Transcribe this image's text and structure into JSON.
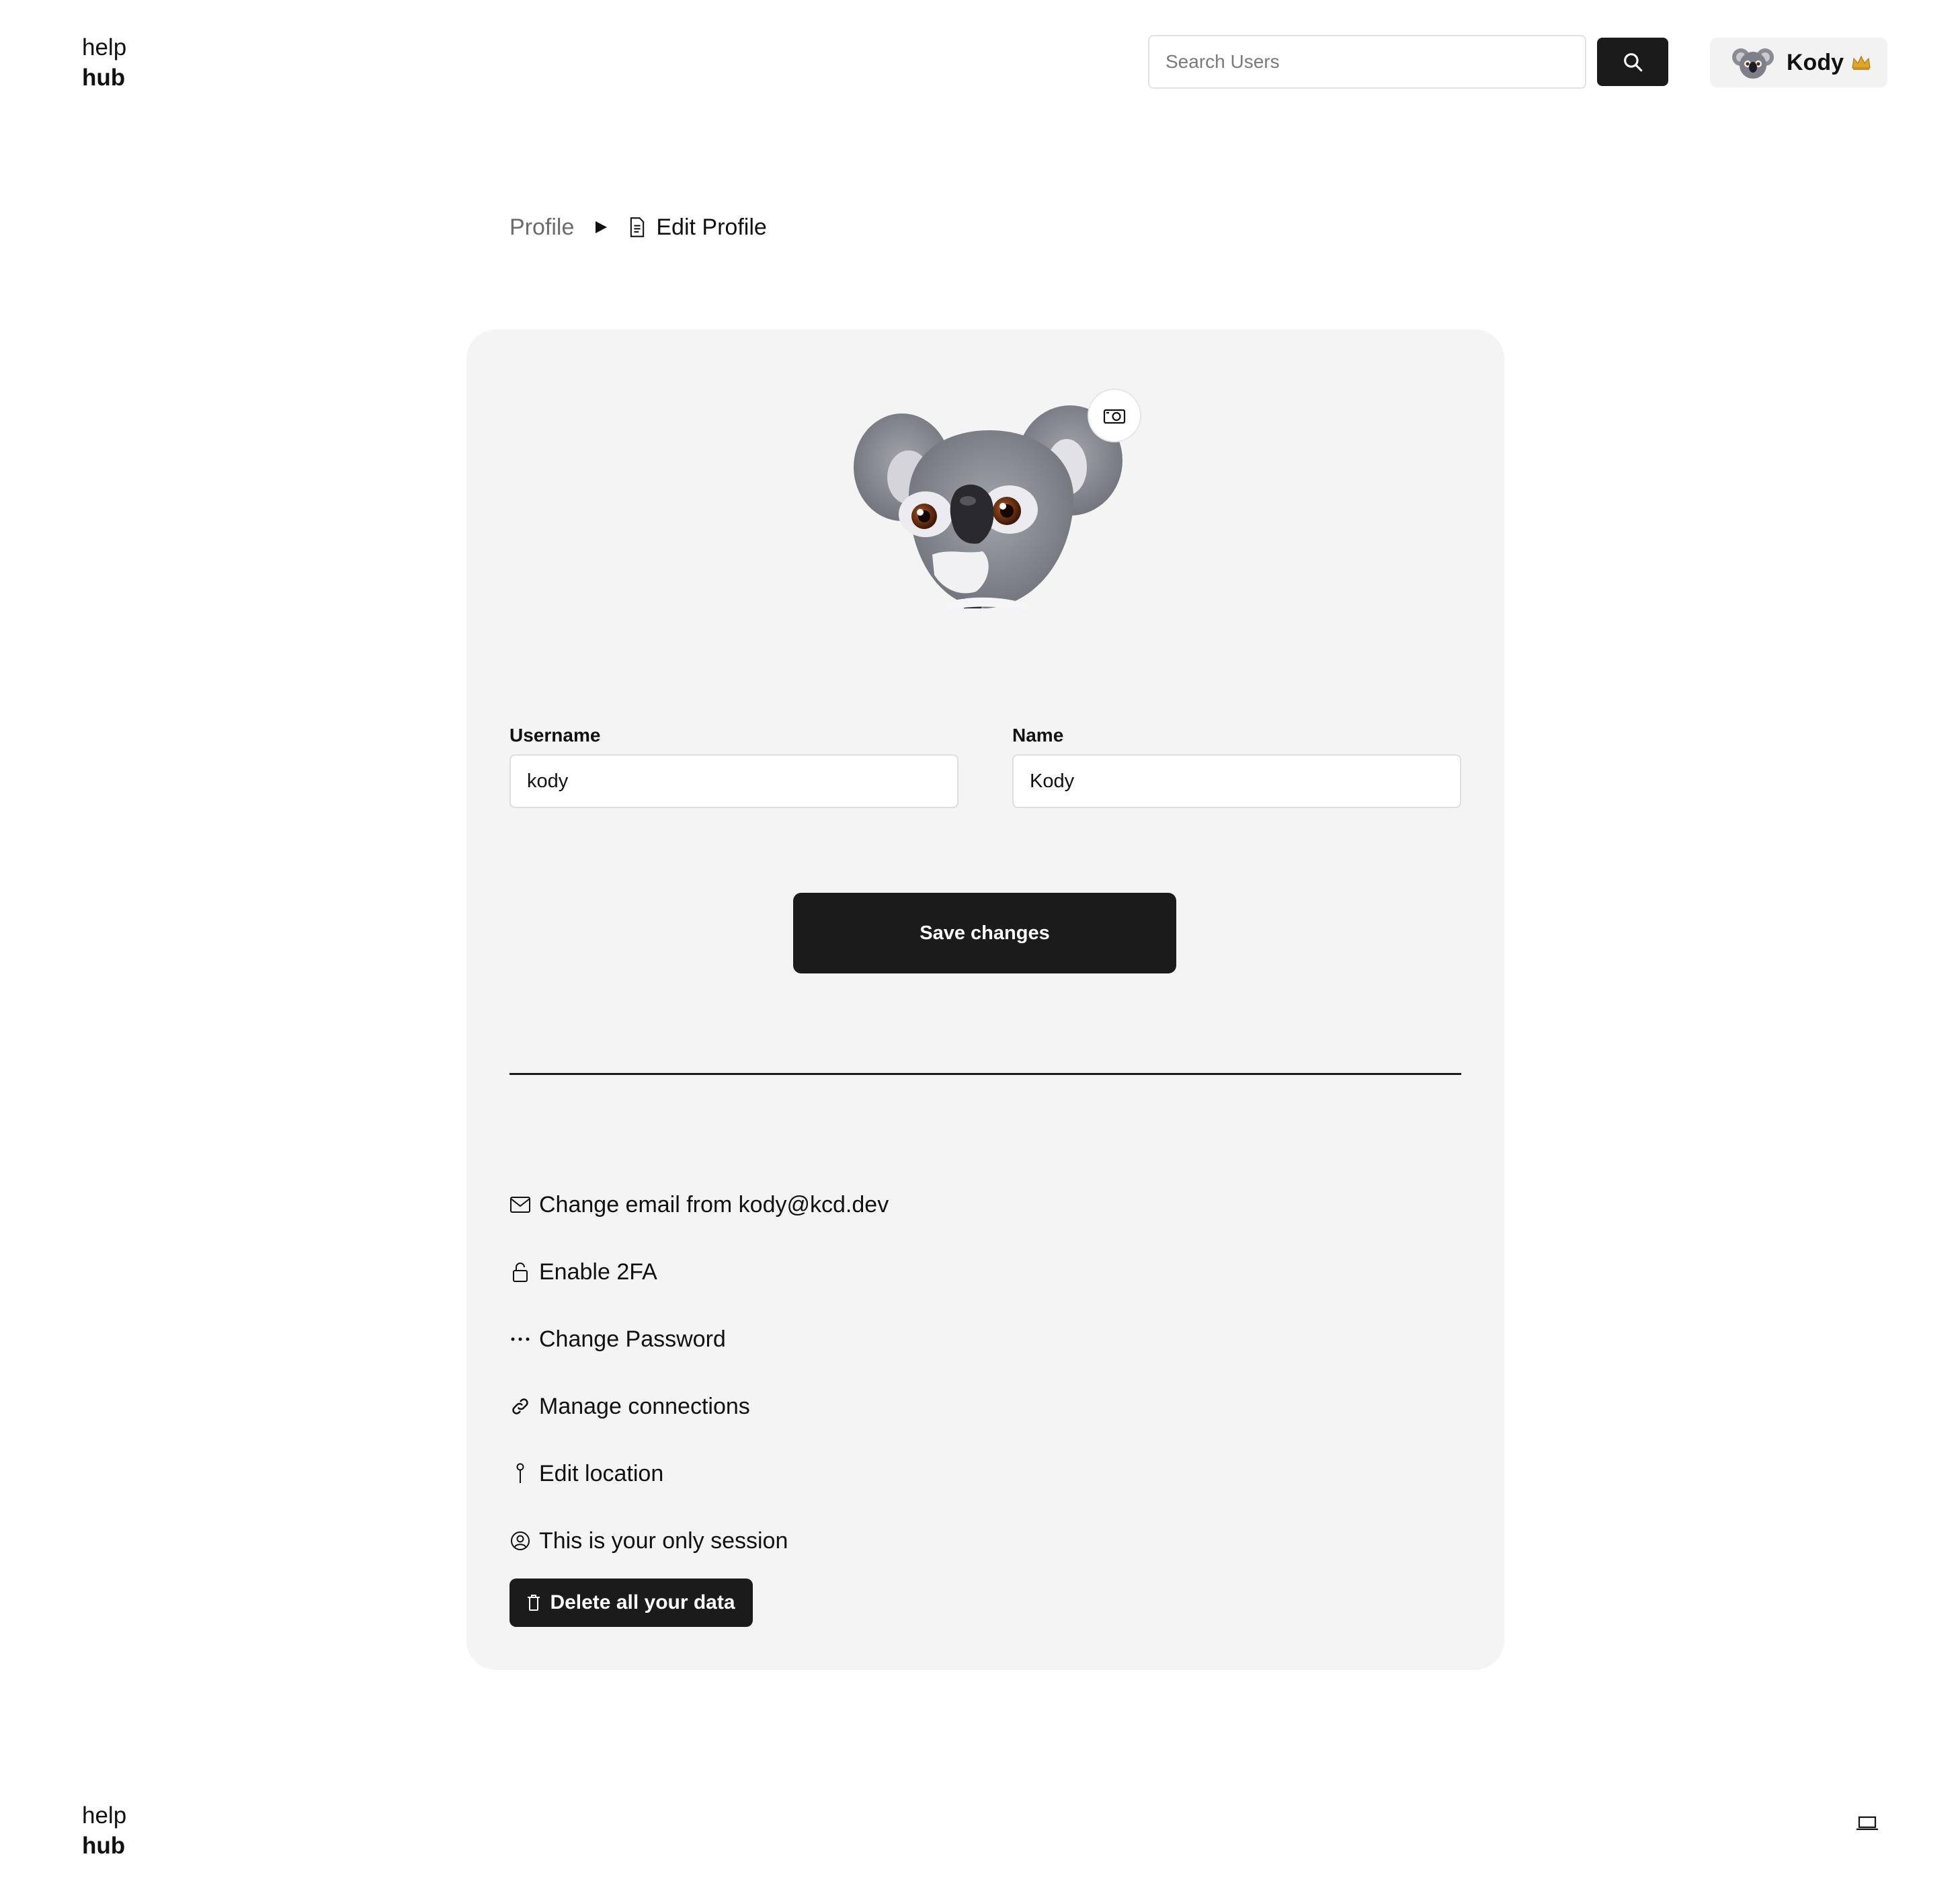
{
  "header": {
    "logo": {
      "line1": "help",
      "line2": "hub"
    },
    "search": {
      "placeholder": "Search Users",
      "value": ""
    },
    "user": {
      "name": "Kody",
      "badge": "👑"
    }
  },
  "breadcrumb": {
    "parent": "Profile",
    "current": "Edit Profile"
  },
  "form": {
    "username": {
      "label": "Username",
      "value": "kody"
    },
    "name": {
      "label": "Name",
      "value": "Kody"
    },
    "save_label": "Save changes"
  },
  "actions": [
    {
      "label": "Change email from kody@kcd.dev",
      "icon": "envelope-icon"
    },
    {
      "label": "Enable 2FA",
      "icon": "lock-icon"
    },
    {
      "label": "Change Password",
      "icon": "dots-icon"
    },
    {
      "label": "Manage connections",
      "icon": "link-icon"
    },
    {
      "label": "Edit location",
      "icon": "pin-icon"
    },
    {
      "label": "This is your only session",
      "icon": "avatar-icon"
    }
  ],
  "delete_label": "Delete all your data",
  "footer": {
    "logo": {
      "line1": "help",
      "line2": "hub"
    }
  },
  "colors": {
    "primary_button": "#1b1b1b",
    "card_background": "#f4f4f4",
    "muted_text": "#6b6b6b"
  }
}
